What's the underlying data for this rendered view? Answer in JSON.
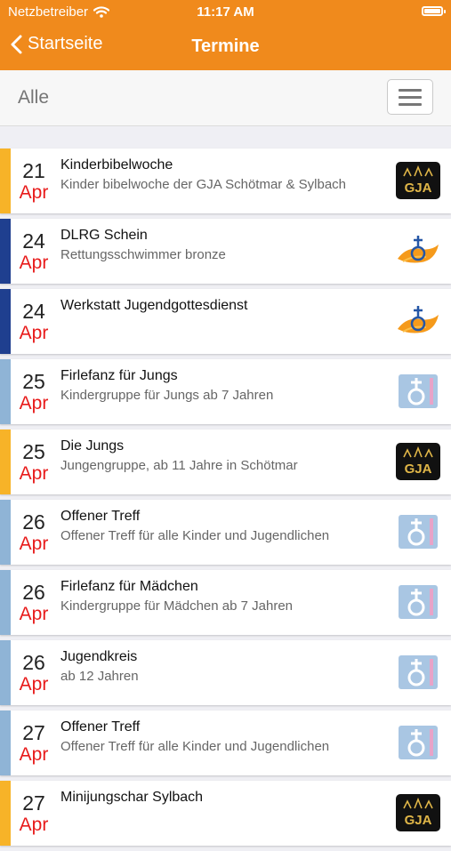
{
  "status_bar": {
    "carrier": "Netzbetreiber",
    "time": "11:17 AM"
  },
  "nav": {
    "back_label": "Startseite",
    "title": "Termine"
  },
  "filter": {
    "label": "Alle"
  },
  "colors": {
    "accent": "#f08a1c",
    "date_month": "#e81b1b",
    "bar_gja": "#f7b328",
    "bar_dlrg": "#1f3f8f",
    "bar_kids": "#8fb4d6"
  },
  "events": [
    {
      "day": "21",
      "month": "Apr",
      "title": "Kinderbibelwoche",
      "subtitle": "Kinder bibelwoche der GJA Schötmar & Sylbach",
      "category": "gja",
      "icon": "gja-logo-icon"
    },
    {
      "day": "24",
      "month": "Apr",
      "title": "DLRG Schein",
      "subtitle": "Rettungsschwimmer bronze",
      "category": "dlrg",
      "icon": "cross-emblem-icon"
    },
    {
      "day": "24",
      "month": "Apr",
      "title": "Werkstatt Jugendgottesdienst",
      "subtitle": "",
      "category": "dlrg",
      "icon": "cross-emblem-icon"
    },
    {
      "day": "25",
      "month": "Apr",
      "title": "Firlefanz für Jungs",
      "subtitle": "Kindergruppe für Jungs ab 7 Jahren",
      "category": "kids",
      "icon": "kids-emblem-icon"
    },
    {
      "day": "25",
      "month": "Apr",
      "title": "Die Jungs",
      "subtitle": "Jungengruppe, ab 11 Jahre in Schötmar",
      "category": "gja",
      "icon": "gja-logo-icon"
    },
    {
      "day": "26",
      "month": "Apr",
      "title": "Offener Treff",
      "subtitle": "Offener Treff für alle Kinder und Jugendlichen",
      "category": "kids",
      "icon": "kids-emblem-icon"
    },
    {
      "day": "26",
      "month": "Apr",
      "title": "Firlefanz für Mädchen",
      "subtitle": "Kindergruppe für Mädchen ab 7 Jahren",
      "category": "kids",
      "icon": "kids-emblem-icon"
    },
    {
      "day": "26",
      "month": "Apr",
      "title": "Jugendkreis",
      "subtitle": "ab 12 Jahren",
      "category": "kids",
      "icon": "kids-emblem-icon"
    },
    {
      "day": "27",
      "month": "Apr",
      "title": "Offener Treff",
      "subtitle": "Offener Treff für alle Kinder und Jugendlichen",
      "category": "kids",
      "icon": "kids-emblem-icon"
    },
    {
      "day": "27",
      "month": "Apr",
      "title": "Minijungschar Sylbach",
      "subtitle": "",
      "category": "gja",
      "icon": "gja-logo-icon"
    }
  ]
}
